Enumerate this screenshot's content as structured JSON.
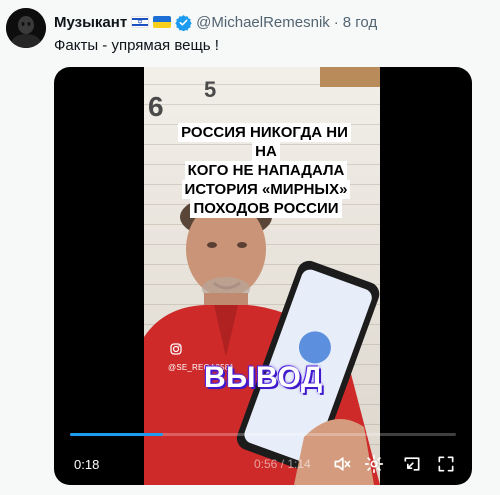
{
  "author": {
    "display_name": "Музыкант",
    "flags": [
      "israel-flag-icon",
      "ukraine-flag-icon"
    ],
    "handle": "@MichaelRemesnik",
    "separator": "·",
    "time": "8 год"
  },
  "tweet": {
    "text": "Факты - упрямая вещь !"
  },
  "video": {
    "overlay_title_lines": [
      "РОССИЯ НИКОГДА НИ НА",
      "КОГО НЕ НАПАДАЛА",
      "ИСТОРИЯ «МИРНЫХ»",
      "ПОХОДОВ РОССИИ"
    ],
    "background_digits": [
      "6",
      "5"
    ],
    "instagram_handle": "@SE_REGA9581",
    "caption": "ВЫВОД",
    "current_time": "0:18",
    "remaining_time": "0:56 / 1:14",
    "progress": 0.24
  },
  "colors": {
    "accent": "#1d9bf0",
    "caption_glow": "#4a1fd6",
    "background": "#f7f9f9"
  }
}
